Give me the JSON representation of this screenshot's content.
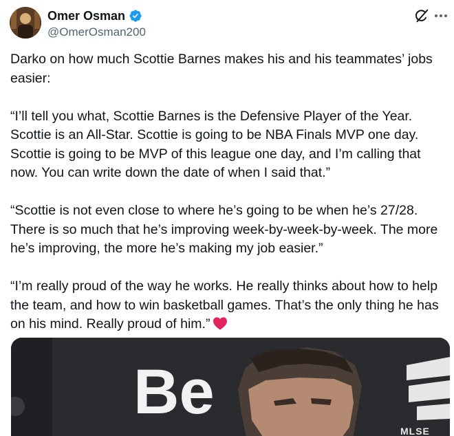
{
  "author": {
    "display_name": "Omer Osman",
    "handle": "@OmerOsman200",
    "verified": true,
    "avatar_icon": "profile-avatar"
  },
  "actions": {
    "grok_icon": "grok-icon",
    "more_icon": "more-options-icon"
  },
  "tweet": {
    "paragraphs": [
      "Darko on how much Scottie Barnes makes his and his teammates’ jobs easier:",
      "“I’ll tell you what, Scottie Barnes is the Defensive Player of the Year. Scottie is an All-Star. Scottie is going to be NBA Finals MVP one day. Scottie is going to be MVP of this league one day, and I’m calling that now. You can write down the date of when I said that.”",
      "“Scottie is not even close to where he’s going to be when he’s 27/28. There is so much that he’s improving week-by-week-by-week. The more he’s improving, the more he’s making my job easier.”",
      "“I’m really proud of the way he works. He really thinks about how to help the team, and how to win basketball games. That’s the only thing he has on his mind. Really proud of him.”"
    ],
    "emoji": "heart-emoji"
  },
  "media": {
    "backdrop_text": "Be",
    "caption_text": "MLSE LAU",
    "colors": {
      "backdrop": "#2a2b2e",
      "accent_white": "#f2f2f2"
    }
  },
  "colors": {
    "text": "#0f1419",
    "secondary": "#536471",
    "verified": "#1d9bf0",
    "heart": "#e0245e"
  }
}
